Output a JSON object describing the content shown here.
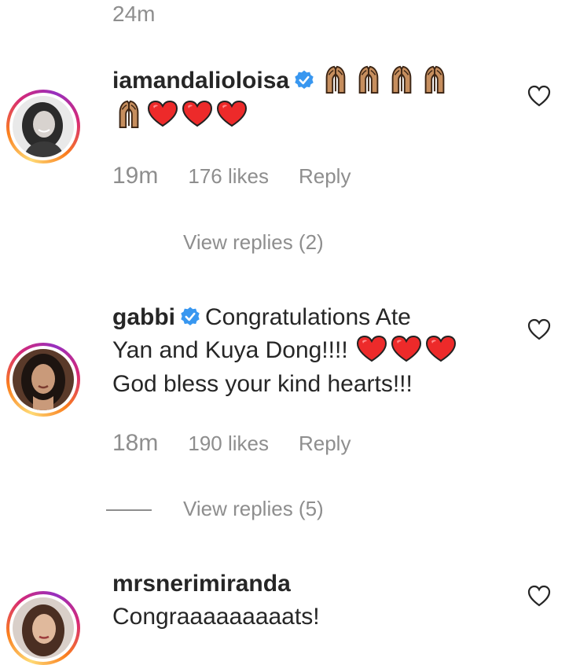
{
  "top_time": "24m",
  "comments": [
    {
      "username": "iamandalioloisa",
      "verified": true,
      "text": "",
      "time": "19m",
      "likes": "176 likes",
      "reply": "Reply",
      "view_replies": "View replies (2)"
    },
    {
      "username": "gabbi",
      "verified": true,
      "text_line1": "Congratulations Ate",
      "text_line2": "Yan and Kuya Dong!!!!",
      "text_line3": "God bless your kind hearts!!!",
      "time": "18m",
      "likes": "190 likes",
      "reply": "Reply",
      "view_replies": "View replies (5)"
    },
    {
      "username": "mrsnerimiranda",
      "verified": false,
      "text": "Congraaaaaaaaats!"
    }
  ],
  "colors": {
    "secondary_text": "#8e8e8e",
    "primary_text": "#262626",
    "verified_blue": "#3897f0",
    "heart_red": "#ed2a2a"
  },
  "icons": [
    "verified-badge-icon",
    "praying-hands-emoji",
    "red-heart-emoji",
    "like-heart-icon"
  ]
}
